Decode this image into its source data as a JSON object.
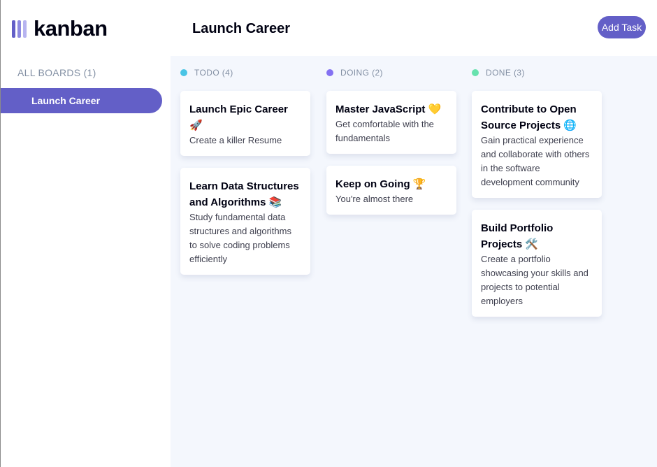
{
  "app": {
    "logo_text": "kanban"
  },
  "sidebar": {
    "heading": "ALL BOARDS (1)",
    "boards": [
      {
        "label": "Launch Career",
        "active": true
      }
    ]
  },
  "header": {
    "title": "Launch Career",
    "add_task_label": "Add Task"
  },
  "columns": [
    {
      "name": "TODO (4)",
      "color": "#49c4e5",
      "cards": [
        {
          "title": "Launch Epic Career 🚀",
          "description": "Create a killer Resume"
        },
        {
          "title": "Learn Data Structures and Algorithms 📚",
          "description": "Study fundamental data structures and algorithms to solve coding problems efficiently"
        }
      ]
    },
    {
      "name": "DOING (2)",
      "color": "#8471f2",
      "cards": [
        {
          "title": "Master JavaScript 💛",
          "description": "Get comfortable with the fundamentals"
        },
        {
          "title": "Keep on Going 🏆",
          "description": "You're almost there"
        }
      ]
    },
    {
      "name": "DONE (3)",
      "color": "#67e2ae",
      "cards": [
        {
          "title": "Contribute to Open Source Projects 🌐",
          "description": "Gain practical experience and collaborate with others in the software development community"
        },
        {
          "title": "Build Portfolio Projects 🛠️",
          "description": "Create a portfolio showcasing your skills and projects to potential employers"
        }
      ]
    }
  ],
  "colors": {
    "accent": "#635fc7",
    "background": "#f4f7fd",
    "surface": "#ffffff",
    "text_primary": "#000112",
    "text_muted": "#828fa3"
  }
}
